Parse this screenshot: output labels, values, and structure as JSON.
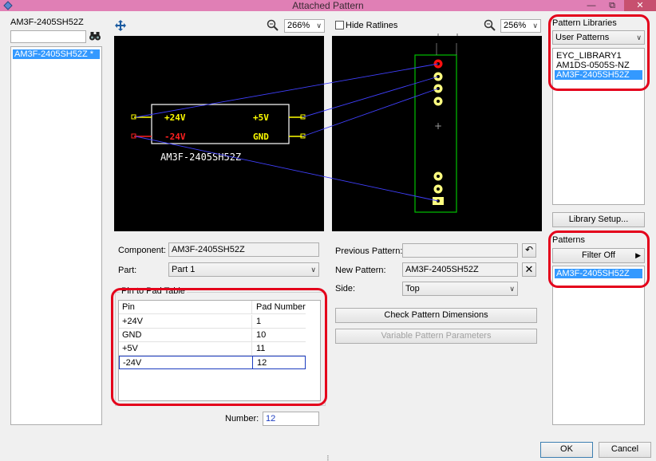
{
  "window": {
    "title": "Attached Pattern",
    "minimize_glyph": "—",
    "restore_glyph": "⧉",
    "close_glyph": "✕"
  },
  "component_panel": {
    "title": "AM3F-2405SH52Z",
    "search_value": "",
    "search_icon": "binoculars-icon",
    "items": [
      {
        "label": "AM3F-2405SH52Z *",
        "selected": true
      }
    ]
  },
  "symbol_view": {
    "zoom_icon": "magnifier-icon",
    "zoom_value": "266%",
    "zoom_arrow": "∨",
    "hide_ratlines_label": "Hide Ratlines",
    "hide_ratlines_checked": false,
    "pins": [
      {
        "label": "+24V",
        "color": "#ffff00"
      },
      {
        "label": "-24V",
        "color": "#ff2020"
      },
      {
        "label": "+5V",
        "color": "#ffff00"
      },
      {
        "label": "GND",
        "color": "#ffff00"
      }
    ],
    "symbol_name": "AM3F-2405SH52Z"
  },
  "pattern_view": {
    "zoom_value": "256%",
    "zoom_arrow": "∨",
    "center_mark": "+"
  },
  "form": {
    "component_label": "Component:",
    "component_value": "AM3F-2405SH52Z",
    "part_label": "Part:",
    "part_value": "Part 1",
    "pin_table_title": "Pin to Pad Table",
    "pin_table_headers": [
      "Pin",
      "Pad Number"
    ],
    "pin_table_rows": [
      {
        "pin": "+24V",
        "pad": "1"
      },
      {
        "pin": "GND",
        "pad": "10"
      },
      {
        "pin": "+5V",
        "pad": "11"
      },
      {
        "pin": "-24V",
        "pad": "12"
      }
    ],
    "number_label": "Number:",
    "number_value": "12",
    "previous_pattern_label": "Previous Pattern:",
    "previous_pattern_value": "",
    "new_pattern_label": "New Pattern:",
    "new_pattern_value": "AM3F-2405SH52Z",
    "side_label": "Side:",
    "side_value": "Top",
    "check_dimensions_label": "Check Pattern Dimensions",
    "variable_params_label": "Variable Pattern Parameters",
    "undo_glyph": "↶",
    "clear_glyph": "✕"
  },
  "libraries": {
    "title": "Pattern Libraries",
    "dropdown_value": "User Patterns",
    "items": [
      {
        "label": "EYC_LIBRARY1",
        "selected": false
      },
      {
        "label": "AM1DS-0505S-NZ",
        "selected": false
      },
      {
        "label": "AM3F-2405SH52Z",
        "selected": true
      }
    ],
    "setup_label": "Library Setup..."
  },
  "patterns": {
    "title": "Patterns",
    "filter_label": "Filter Off",
    "filter_arrow": "▶",
    "items": [
      {
        "label": "AM3F-2405SH52Z",
        "selected": true
      }
    ]
  },
  "footer": {
    "ok_label": "OK",
    "cancel_label": "Cancel",
    "grip_glyph": "⠇"
  },
  "colors": {
    "accent": "#3399ff",
    "highlight": "#e4001b",
    "pad": "#ffff00",
    "ratline": "#4040ff",
    "outline": "#00c000"
  }
}
